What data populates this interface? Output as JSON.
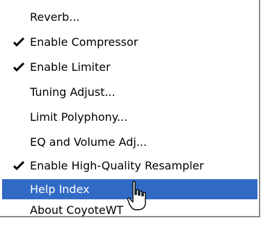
{
  "menu": {
    "items": [
      {
        "label": "Reverb...",
        "checked": false
      },
      {
        "label": "Enable Compressor",
        "checked": true
      },
      {
        "label": "Enable Limiter",
        "checked": true
      },
      {
        "label": "Tuning Adjust...",
        "checked": false
      },
      {
        "label": "Limit Polyphony...",
        "checked": false
      },
      {
        "label": "EQ and Volume Adj...",
        "checked": false
      },
      {
        "label": "Enable High-Quality Resampler",
        "checked": true
      },
      {
        "label": "Help Index",
        "checked": false,
        "highlighted": true
      },
      {
        "label": "About CoyoteWT",
        "checked": false
      }
    ]
  },
  "colors": {
    "highlight": "#316ac5",
    "highlight_text": "#ffffff",
    "text": "#000000"
  },
  "icons": {
    "check": "checkmark-icon",
    "cursor": "hand-pointer-cursor"
  }
}
